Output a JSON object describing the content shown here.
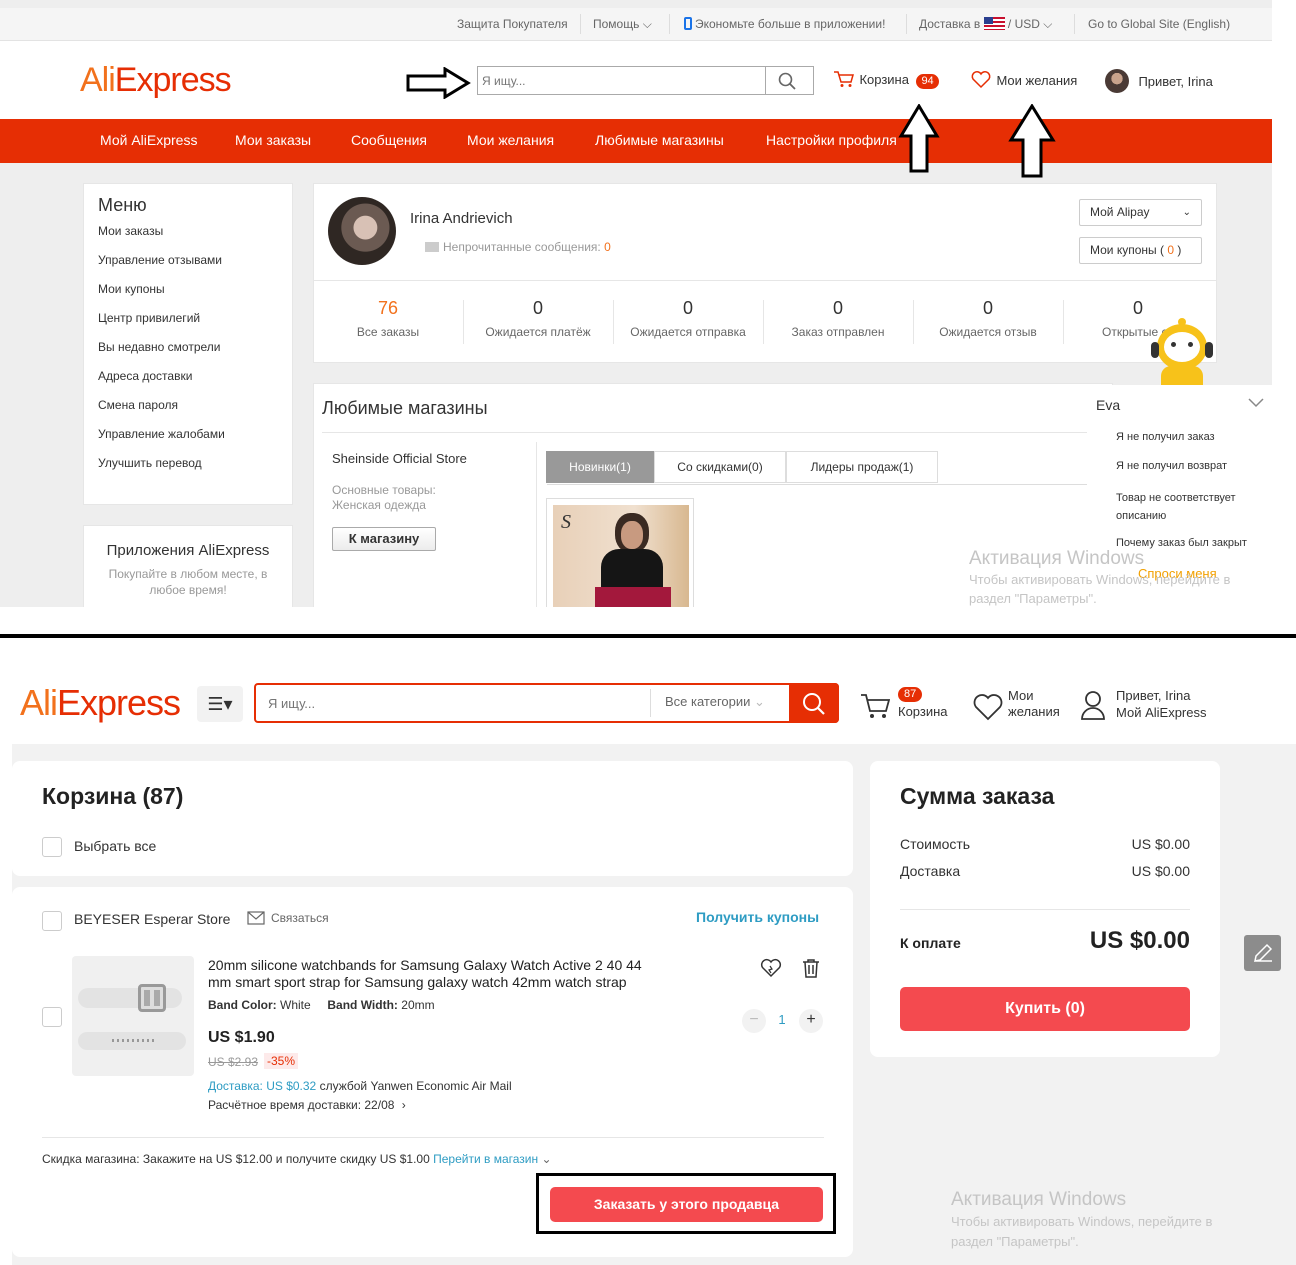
{
  "top": {
    "topbar": {
      "buyer_protection": "Защита Покупателя",
      "help": "Помощь",
      "app_promo": "Экономьте больше в приложении!",
      "ship_to": "Доставка в",
      "currency": "USD",
      "global_site": "Go to Global Site (English)"
    },
    "logo": {
      "part1": "Ali",
      "part2": "Express"
    },
    "search": {
      "placeholder": "Я ищу..."
    },
    "cart": {
      "label": "Корзина",
      "count": "94"
    },
    "wishlist": {
      "label": "Мои желания"
    },
    "greeting": "Привет, Irina",
    "nav": [
      "Мой AliExpress",
      "Мои заказы",
      "Сообщения",
      "Мои желания",
      "Любимые магазины",
      "Настройки профиля"
    ],
    "menu": {
      "title": "Меню",
      "items": [
        "Мои заказы",
        "Управление отзывами",
        "Мои купоны",
        "Центр привилегий",
        "Вы недавно смотрели",
        "Адреса доставки",
        "Смена пароля",
        "Управление жалобами",
        "Улучшить перевод"
      ]
    },
    "apps": {
      "title": "Приложения AliExpress",
      "subtitle": "Покупайте в любом месте, в любое время!"
    },
    "profile": {
      "name": "Irina Andrievich",
      "unread_label": "Непрочитанные сообщения:",
      "unread_count": "0",
      "alipay": "Мой Alipay",
      "coupons_label": "Мои купоны (",
      "coupons_count": "0",
      "coupons_close": ")"
    },
    "stats": [
      {
        "value": "76",
        "label": "Все заказы"
      },
      {
        "value": "0",
        "label": "Ожидается платёж"
      },
      {
        "value": "0",
        "label": "Ожидается отправка"
      },
      {
        "value": "0",
        "label": "Заказ отправлен"
      },
      {
        "value": "0",
        "label": "Ожидается отзыв"
      },
      {
        "value": "0",
        "label": "Открытые сп"
      }
    ],
    "fav": {
      "title": "Любимые магазины",
      "store_name": "Sheinside Official Store",
      "main_goods_label": "Основные товары:",
      "main_goods": "Женская одежда",
      "to_store": "К магазину",
      "tabs": [
        "Новинки(1)",
        "Со скидками(0)",
        "Лидеры продаж(1)"
      ]
    },
    "assistant": {
      "name": "Eva",
      "items": [
        "Я не получил заказ",
        "Я не получил возврат",
        "Товар не соответствует описанию",
        "Почему заказ был закрыт"
      ],
      "ask": "Спроси меня"
    },
    "windows": {
      "title": "Активация Windows",
      "line1": "Чтобы активировать Windows, перейдите в",
      "line2": "раздел \"Параметры\"."
    }
  },
  "bottom": {
    "logo": {
      "part1": "Ali",
      "part2": "Express"
    },
    "search": {
      "placeholder": "Я ищу...",
      "category": "Все категории"
    },
    "cart": {
      "label": "Корзина",
      "count": "87"
    },
    "wishlist": {
      "line1": "Мои",
      "line2": "желания"
    },
    "account": {
      "greeting": "Привет, Irina",
      "link": "Мой AliExpress"
    },
    "cart_title": "Корзина (87)",
    "select_all": "Выбрать все",
    "store": {
      "name": "BEYESER Esperar Store",
      "contact": "Связаться",
      "coupons": "Получить купоны"
    },
    "product": {
      "title_line1": "20mm silicone watchbands for Samsung Galaxy Watch Active 2 40 44",
      "title_line2": "mm smart sport strap for Samsung galaxy watch 42mm watch strap",
      "color_label": "Band Color:",
      "color_value": "White",
      "width_label": "Band Width:",
      "width_value": "20mm",
      "price": "US $1.90",
      "old_price": "US $2.93",
      "discount": "-35%",
      "ship_label": "Доставка: US $0.32",
      "ship_service": "службой Yanwen Economic Air Mail",
      "eta": "Расчётное время доставки: 22/08",
      "qty": "1"
    },
    "store_discount": {
      "text": "Скидка магазина:  Закажите на US $12.00 и получите скидку US $1.00",
      "link": "Перейти в магазин"
    },
    "order_seller": "Заказать у этого продавца",
    "summary": {
      "title": "Сумма заказа",
      "cost_label": "Стоимость",
      "cost_value": "US $0.00",
      "ship_label": "Доставка",
      "ship_value": "US $0.00",
      "total_label": "К оплате",
      "total_value": "US $0.00",
      "buy": "Купить (0)"
    },
    "windows": {
      "title": "Активация Windows",
      "line1": "Чтобы активировать Windows, перейдите в",
      "line2": "раздел \"Параметры\"."
    }
  },
  "colors": {
    "brand_red": "#e62e04",
    "brand_orange": "#f2711c",
    "button_red": "#f44a4f",
    "link_blue": "#2e9cc3"
  }
}
